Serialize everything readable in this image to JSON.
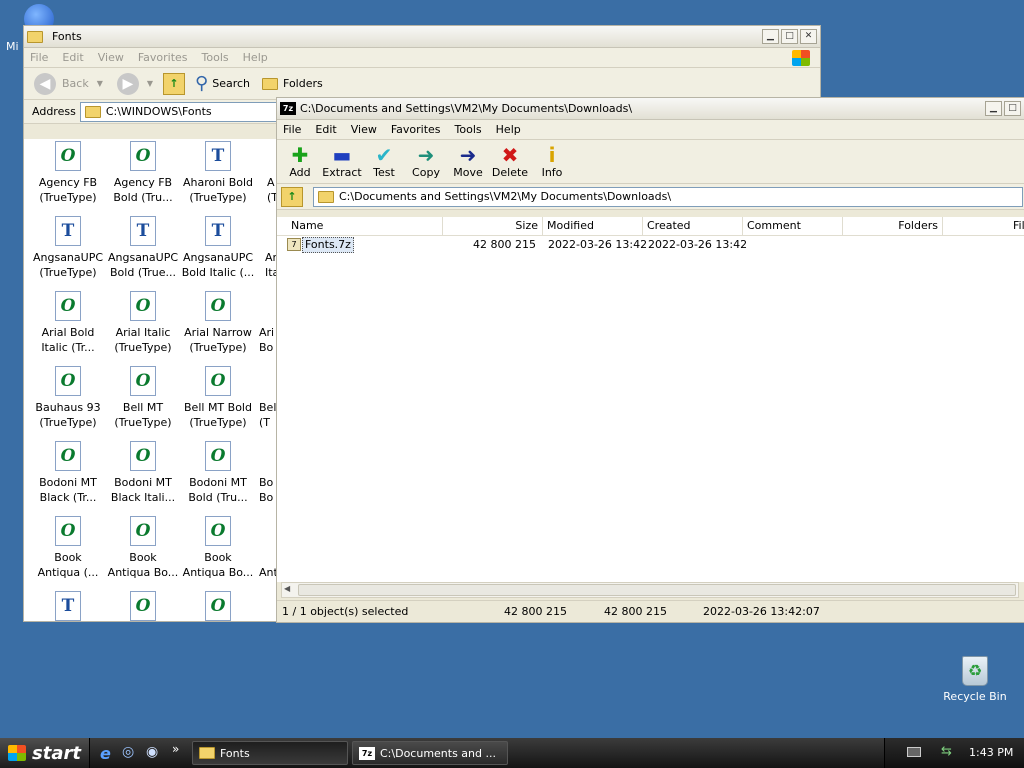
{
  "desktop": {
    "partial_icon_label": "Mi",
    "recycle_bin_label": "Recycle Bin"
  },
  "fonts_window": {
    "title": "Fonts",
    "menu": [
      "File",
      "Edit",
      "View",
      "Favorites",
      "Tools",
      "Help"
    ],
    "toolbar": {
      "back_label": "Back",
      "search_label": "Search",
      "folders_label": "Folders"
    },
    "address": {
      "label": "Address",
      "path": "C:\\WINDOWS\\Fonts"
    },
    "items": [
      {
        "line1": "Agency FB",
        "line2": "(TrueType)",
        "icon": "o"
      },
      {
        "line1": "Agency FB",
        "line2": "Bold (Tru...",
        "icon": "o"
      },
      {
        "line1": "Aharoni Bold",
        "line2": "(TrueType)",
        "icon": "t"
      },
      {
        "line1": "A",
        "line2": "(T",
        "icon": "o"
      },
      {
        "line1": "AngsanaUPC",
        "line2": "(TrueType)",
        "icon": "t"
      },
      {
        "line1": "AngsanaUPC",
        "line2": "Bold (True...",
        "icon": "t"
      },
      {
        "line1": "AngsanaUPC",
        "line2": "Bold Italic (...",
        "icon": "t"
      },
      {
        "line1": "An",
        "line2": "Ital",
        "icon": "t"
      },
      {
        "line1": "Arial Bold",
        "line2": "Italic (Tr...",
        "icon": "o"
      },
      {
        "line1": "Arial Italic",
        "line2": "(TrueType)",
        "icon": "o"
      },
      {
        "line1": "Arial Narrow",
        "line2": "(TrueType)",
        "icon": "o"
      },
      {
        "line1": "Ari",
        "line2": "Bo",
        "icon": "o"
      },
      {
        "line1": "Bauhaus 93",
        "line2": "(TrueType)",
        "icon": "o"
      },
      {
        "line1": "Bell MT",
        "line2": "(TrueType)",
        "icon": "o"
      },
      {
        "line1": "Bell MT Bold",
        "line2": "(TrueType)",
        "icon": "o"
      },
      {
        "line1": "Bel",
        "line2": "(T",
        "icon": "o"
      },
      {
        "line1": "Bodoni MT",
        "line2": "Black (Tr...",
        "icon": "o"
      },
      {
        "line1": "Bodoni MT",
        "line2": "Black Itali...",
        "icon": "o"
      },
      {
        "line1": "Bodoni MT",
        "line2": "Bold (Tru...",
        "icon": "o"
      },
      {
        "line1": "Bo",
        "line2": "Bo",
        "icon": "o"
      },
      {
        "line1": "Book",
        "line2": "Antiqua (...",
        "icon": "o"
      },
      {
        "line1": "Book",
        "line2": "Antiqua Bo...",
        "icon": "o"
      },
      {
        "line1": "Book",
        "line2": "Antiqua Bo...",
        "icon": "o"
      },
      {
        "line1": "",
        "line2": "Ant",
        "icon": "o"
      },
      {
        "line1": "",
        "line2": "",
        "icon": "t"
      },
      {
        "line1": "",
        "line2": "",
        "icon": "o"
      },
      {
        "line1": "",
        "line2": "",
        "icon": "o"
      }
    ]
  },
  "sevenzip_window": {
    "title": "C:\\Documents and Settings\\VM2\\My Documents\\Downloads\\",
    "menu": [
      "File",
      "Edit",
      "View",
      "Favorites",
      "Tools",
      "Help"
    ],
    "toolbar": [
      {
        "label": "Add",
        "glyph": "✚",
        "color": "#1aa31a"
      },
      {
        "label": "Extract",
        "glyph": "▬",
        "color": "#1f3fbf"
      },
      {
        "label": "Test",
        "glyph": "✔",
        "color": "#2bb5c9"
      },
      {
        "label": "Copy",
        "glyph": "➜",
        "color": "#1e8f7a"
      },
      {
        "label": "Move",
        "glyph": "➜",
        "color": "#1a2a8c"
      },
      {
        "label": "Delete",
        "glyph": "✖",
        "color": "#d01818"
      },
      {
        "label": "Info",
        "glyph": "i",
        "color": "#d9a400"
      }
    ],
    "path": "C:\\Documents and Settings\\VM2\\My Documents\\Downloads\\",
    "columns": [
      "Name",
      "Size",
      "Modified",
      "Created",
      "Comment",
      "Folders",
      "Fil"
    ],
    "rows": [
      {
        "name": "Fonts.7z",
        "size": "42 800 215",
        "modified": "2022-03-26 13:42",
        "created": "2022-03-26 13:42"
      }
    ],
    "status": {
      "selection": "1 / 1 object(s) selected",
      "size": "42 800 215",
      "packed": "42 800 215",
      "date": "2022-03-26 13:42:07"
    }
  },
  "taskbar": {
    "start_label": "start",
    "tasks": [
      "Fonts",
      "C:\\Documents and ..."
    ],
    "clock": "1:43 PM"
  }
}
